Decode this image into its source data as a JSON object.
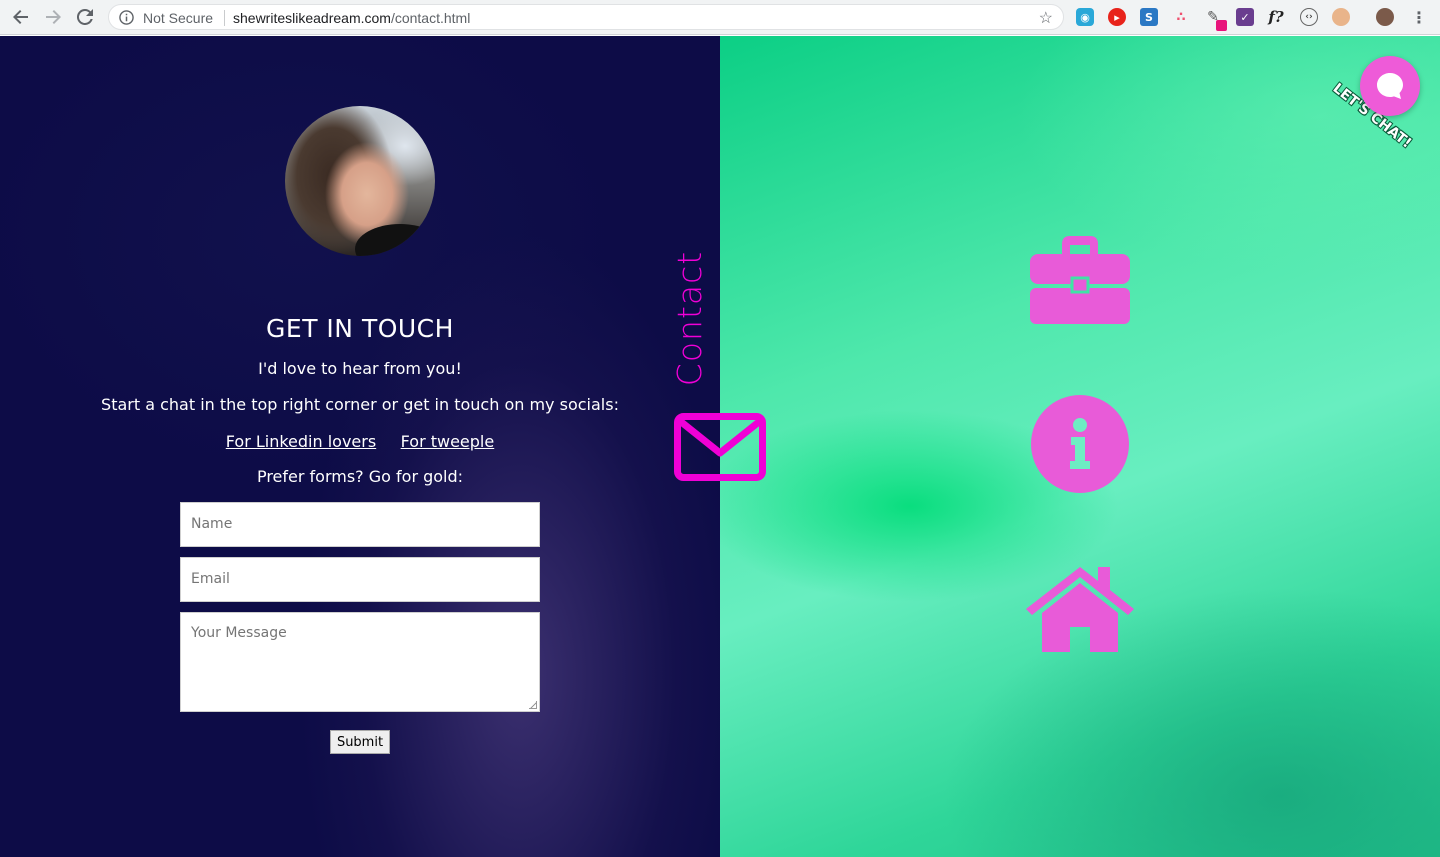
{
  "browser": {
    "security_label": "Not Secure",
    "url_domain": "shewriteslikeadream.com",
    "url_path": "/contact.html",
    "extensions": [
      "extension-icon",
      "video-extension-icon",
      "s-extension-icon",
      "dots-extension-icon",
      "eyedropper-extension-icon",
      "checkbox-extension-icon",
      "font-extension-icon",
      "code-extension-icon",
      "color-extension-icon",
      "profile-avatar"
    ],
    "font_ext_label": "f?"
  },
  "contact": {
    "vertical_label": "Contact",
    "title": "GET IN TOUCH",
    "greeting": "I'd love to hear from you!",
    "intro": "Start a chat in the top right corner or get in touch on my socials:",
    "link_linkedin": "For Linkedin lovers",
    "link_twitter": "For tweeple",
    "forms_prompt": "Prefer forms? Go for gold:"
  },
  "form": {
    "name_placeholder": "Name",
    "email_placeholder": "Email",
    "message_placeholder": "Your Message",
    "submit_label": "Submit"
  },
  "nav_icons": [
    "briefcase-icon",
    "info-icon",
    "home-icon"
  ],
  "chat": {
    "label": "LET'S CHAT!"
  },
  "colors": {
    "accent_pink": "#f000d6",
    "icon_pink": "#e85bd8",
    "left_bg": "#0d0c47",
    "right_bg": "#4fe8ac"
  }
}
